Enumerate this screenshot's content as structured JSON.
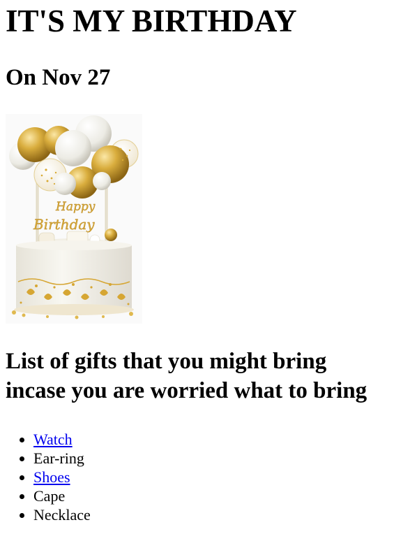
{
  "page": {
    "title": "IT'S MY BIRTHDAY",
    "date_heading": "On Nov 27",
    "gifts_heading": "List of gifts that you might bring incase you are worried what to bring"
  },
  "image": {
    "topper_text_1": "Happy",
    "topper_text_2": "Birthday"
  },
  "gifts": {
    "items": [
      {
        "label": "Watch",
        "is_link": true
      },
      {
        "label": "Ear-ring",
        "is_link": false
      },
      {
        "label": "Shoes",
        "is_link": true
      },
      {
        "label": "Cape",
        "is_link": false
      },
      {
        "label": "Necklace",
        "is_link": false
      }
    ]
  },
  "colors": {
    "link": "#0000ee",
    "gold": "#d4a62a",
    "cream": "#f3f0e6"
  }
}
